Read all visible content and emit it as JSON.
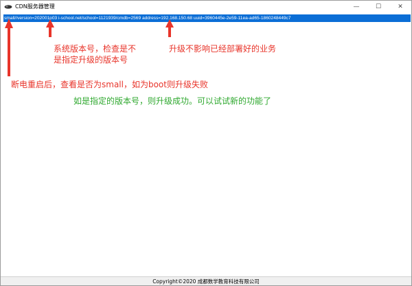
{
  "window": {
    "title": "CDN服务器管理",
    "controls": {
      "minimize": "—",
      "maximize": "☐",
      "close": "✕"
    }
  },
  "list": {
    "selected_row": "small//version=202001p03 i-school.net/school=1121939/cmdb=2569 address=192.168.150.68 uuid=3960445e-2e59-11ea-ad65-1860248449c7"
  },
  "annotations": {
    "version_note_line1": "系统版本号，检查是不",
    "version_note_line2": "是指定升级的版本号",
    "upgrade_note": "升级不影响已经部署好的业务",
    "boot_note": "断电重启后，查看是否为small，如为boot则升级失败",
    "success_note": "如是指定的版本号，则升级成功。可以试试新的功能了",
    "arrow_color": "#e8342a"
  },
  "footer": {
    "copyright": "Copyright©2020 成都数学教育科技有限公司"
  }
}
